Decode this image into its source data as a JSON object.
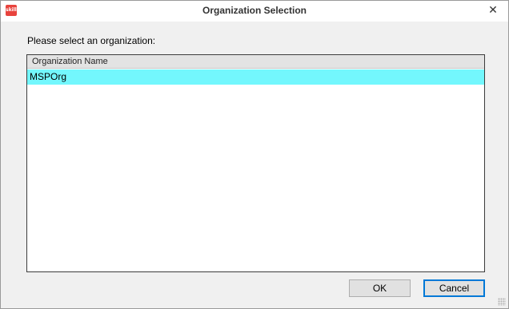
{
  "window": {
    "title": "Organization Selection",
    "app_icon_text": "skill",
    "close_glyph": "✕"
  },
  "prompt": "Please select an organization:",
  "list": {
    "columns": [
      "Organization Name"
    ],
    "rows": [
      "MSPOrg"
    ],
    "selected_row_color": "#73f7fd"
  },
  "buttons": {
    "ok_label": "OK",
    "cancel_label": "Cancel"
  }
}
